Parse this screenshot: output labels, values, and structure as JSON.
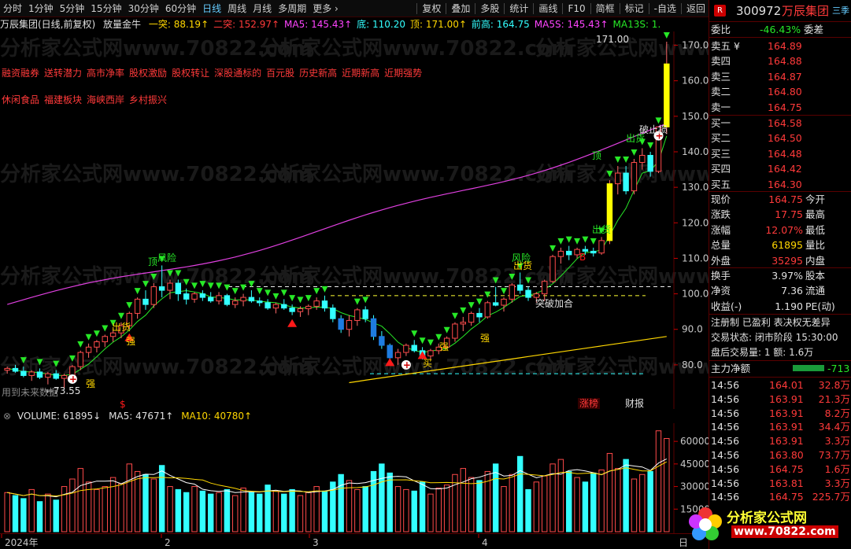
{
  "toolbar": {
    "left": [
      "分时",
      "1分钟",
      "5分钟",
      "15分钟",
      "30分钟",
      "60分钟",
      "日线",
      "周线",
      "月线",
      "多周期",
      "更多 ›"
    ],
    "active": "日线",
    "right": [
      "复权",
      "叠加",
      "多股",
      "统计",
      "画线",
      "F10",
      "简框",
      "标记",
      "-自选",
      "返回"
    ]
  },
  "title_row": {
    "name": "万辰集团(日线,前复权)",
    "indicator": "放量金牛",
    "items": [
      {
        "label": "一突: 88.19↑",
        "color": "#ffd700"
      },
      {
        "label": "二突: 152.97↑",
        "color": "#ff3a3a"
      },
      {
        "label": "MA5: 145.43↑",
        "color": "#ff44ff"
      },
      {
        "label": "底: 110.20",
        "color": "#33ffff"
      },
      {
        "label": "顶: 171.00↑",
        "color": "#ffd700"
      },
      {
        "label": "前高: 164.75",
        "color": "#33ffff"
      },
      {
        "label": "MA5S: 145.43↑",
        "color": "#ff44ff"
      },
      {
        "label": "MA13S: 1.",
        "color": "#27e827"
      }
    ]
  },
  "tags1": [
    "融资融券",
    "送转潜力",
    "高市净率",
    "股权激励",
    "股权转让",
    "深股通标的",
    "百元股",
    "历史新高",
    "近期新高",
    "近期强势"
  ],
  "tags2": [
    "休闲食品",
    "福建板块",
    "海峡西岸",
    "乡村振兴"
  ],
  "price_axis": [
    "170.0",
    "160.0",
    "150.0",
    "140.0",
    "130.0",
    "120.0",
    "110.0",
    "100.0",
    "90.0",
    "80.0"
  ],
  "chart_labels": {
    "high_mark": "171.00",
    "low_mark": "73.55",
    "future_text": "用到未来数据",
    "breakout": "突破加合",
    "stoploss": "破止损",
    "signal_top": "顶",
    "signal_risk": "风险",
    "signal_ship": "出货",
    "signal_strong": "强",
    "signal_buy": "买",
    "signal_b": "B",
    "signal_s": "$",
    "zt_tag": "涨榜",
    "cb_tag": "财报"
  },
  "volume_header": {
    "name": "VOLUME: 61895↓",
    "ma5": "MA5: 47671↑",
    "ma10": "MA10: 40780↑"
  },
  "volume_axis": [
    "60000",
    "45000",
    "30000",
    "15000"
  ],
  "date_axis": [
    "2024年",
    "2",
    "3",
    "4"
  ],
  "date_end": "日",
  "right_panel": {
    "code": "300972",
    "name": "万辰集团",
    "badge": "R",
    "wb_label": "委比",
    "wb_value": "-46.43%",
    "wc_label": "委差",
    "sells": [
      {
        "label": "卖五",
        "price": "164.89",
        "flag": "¥"
      },
      {
        "label": "卖四",
        "price": "164.88",
        "flag": ""
      },
      {
        "label": "卖三",
        "price": "164.87",
        "flag": ""
      },
      {
        "label": "卖二",
        "price": "164.80",
        "flag": ""
      },
      {
        "label": "卖一",
        "price": "164.75",
        "flag": ""
      }
    ],
    "buys": [
      {
        "label": "买一",
        "price": "164.58"
      },
      {
        "label": "买二",
        "price": "164.50"
      },
      {
        "label": "买三",
        "price": "164.48"
      },
      {
        "label": "买四",
        "price": "164.42"
      },
      {
        "label": "买五",
        "price": "164.30"
      }
    ],
    "quote": [
      {
        "l1": "现价",
        "v1": "164.75",
        "c1": "red",
        "l2": "今开"
      },
      {
        "l1": "涨跌",
        "v1": "17.75",
        "c1": "red",
        "l2": "最高"
      },
      {
        "l1": "涨幅",
        "v1": "12.07%",
        "c1": "red",
        "l2": "最低"
      },
      {
        "l1": "总量",
        "v1": "61895",
        "c1": "yel",
        "l2": "量比"
      },
      {
        "l1": "外盘",
        "v1": "35295",
        "c1": "red",
        "l2": "内盘"
      }
    ],
    "info": [
      {
        "l1": "换手",
        "v1": "3.97%",
        "l2": "股本"
      },
      {
        "l1": "净资",
        "v1": "7.36",
        "l2": "流通"
      },
      {
        "l1": "收益(-)",
        "v1": "1.190",
        "l2": "PE(动)"
      }
    ],
    "status1": "注册制  已盈利  表决权无差异",
    "status2": "交易状态: 闭市阶段 15:30:00",
    "status3": "盘后交易量: 1  额: 1.6万",
    "main_force_label": "主力净额",
    "main_force_value": "-713",
    "ticks": [
      {
        "t": "14:56",
        "p": "164.01",
        "v": "32.8万"
      },
      {
        "t": "14:56",
        "p": "163.91",
        "v": "21.3万"
      },
      {
        "t": "14:56",
        "p": "163.91",
        "v": "8.2万"
      },
      {
        "t": "14:56",
        "p": "163.91",
        "v": "34.4万"
      },
      {
        "t": "14:56",
        "p": "163.91",
        "v": "3.3万"
      },
      {
        "t": "14:56",
        "p": "163.80",
        "v": "73.7万"
      },
      {
        "t": "14:56",
        "p": "164.75",
        "v": "1.6万"
      },
      {
        "t": "14:56",
        "p": "163.81",
        "v": "3.3万"
      },
      {
        "t": "14:56",
        "p": "164.75",
        "v": "225.7万"
      }
    ],
    "side_tab": "三季",
    "logo_text": "分析家公式网",
    "logo_url": "www.70822.com"
  },
  "watermark": "分析家公式网www.70822.com",
  "chart_data": {
    "type": "candlestick",
    "ylim": [
      72,
      173
    ],
    "candles": [
      [
        78.5,
        79.5,
        77.5,
        79
      ],
      [
        79,
        80,
        77.8,
        78.2
      ],
      [
        78.2,
        79.5,
        76.5,
        77
      ],
      [
        77,
        78.5,
        75.5,
        78
      ],
      [
        78,
        79,
        76,
        76.5
      ],
      [
        76.5,
        78,
        74.5,
        77.5
      ],
      [
        77.5,
        78.5,
        75.8,
        76.2
      ],
      [
        76.2,
        77.5,
        73.55,
        77
      ],
      [
        77,
        80,
        76,
        79.5
      ],
      [
        79.5,
        84,
        78.5,
        83.5
      ],
      [
        83.5,
        86,
        82,
        85
      ],
      [
        85,
        87,
        83.5,
        86.5
      ],
      [
        86.5,
        88.5,
        85,
        88
      ],
      [
        88,
        90,
        86.5,
        89
      ],
      [
        89,
        92,
        87.5,
        91
      ],
      [
        91,
        95,
        90,
        94.5
      ],
      [
        94.5,
        99,
        93,
        98.5
      ],
      [
        98.5,
        101,
        95.5,
        97
      ],
      [
        97,
        103,
        96,
        102
      ],
      [
        102,
        108,
        99,
        101
      ],
      [
        101,
        104,
        98.5,
        103
      ],
      [
        103,
        104,
        98,
        100
      ],
      [
        100,
        101.5,
        97,
        98.5
      ],
      [
        98.5,
        100.5,
        97.5,
        100
      ],
      [
        100,
        101,
        98,
        99
      ],
      [
        99,
        100.5,
        97.5,
        98
      ],
      [
        98,
        100.5,
        97,
        99.5
      ],
      [
        99.5,
        100,
        96.5,
        97
      ],
      [
        97,
        99,
        96,
        98
      ],
      [
        98,
        100,
        96.5,
        99
      ],
      [
        99,
        101,
        97.5,
        98
      ],
      [
        98,
        99,
        96.5,
        97.5
      ],
      [
        97.5,
        98.5,
        95.5,
        96
      ],
      [
        96,
        97.5,
        94.5,
        97
      ],
      [
        97,
        98.5,
        95.5,
        96
      ],
      [
        96,
        97,
        94,
        95
      ],
      [
        95,
        96.5,
        93.5,
        95.8
      ],
      [
        95.8,
        97,
        94,
        96.5
      ],
      [
        96.5,
        99,
        95.5,
        98
      ],
      [
        98,
        99.5,
        95,
        96
      ],
      [
        96,
        97,
        92,
        93
      ],
      [
        93,
        94,
        89,
        90
      ],
      [
        90,
        94,
        88,
        92.5
      ],
      [
        92.5,
        96,
        91,
        95.5
      ],
      [
        95.5,
        96.5,
        92,
        93
      ],
      [
        93,
        94,
        87,
        88
      ],
      [
        88,
        89.5,
        84.5,
        85.5
      ],
      [
        85.5,
        86,
        80.5,
        82
      ],
      [
        82,
        84.5,
        80,
        83.5
      ],
      [
        83.5,
        86,
        82.5,
        85.5
      ],
      [
        85.5,
        87,
        83.5,
        84
      ],
      [
        84,
        85,
        81.5,
        82.5
      ],
      [
        82.5,
        84.5,
        81.5,
        84
      ],
      [
        84,
        86,
        83,
        85
      ],
      [
        85,
        88,
        84.5,
        87.5
      ],
      [
        87.5,
        92,
        86.5,
        91.5
      ],
      [
        91.5,
        93.5,
        89.5,
        92
      ],
      [
        92,
        95,
        91,
        94.5
      ],
      [
        94.5,
        96,
        92,
        93.5
      ],
      [
        93.5,
        98,
        93,
        97.5
      ],
      [
        97.5,
        102,
        96.5,
        96.8
      ],
      [
        96.8,
        99,
        95,
        98.5
      ],
      [
        98.5,
        103,
        97.5,
        102.5
      ],
      [
        102.5,
        106,
        100,
        101
      ],
      [
        101,
        102,
        98,
        99
      ],
      [
        99,
        100.5,
        97.5,
        100
      ],
      [
        100,
        104,
        98,
        103.5
      ],
      [
        103.5,
        111,
        103,
        110.5
      ],
      [
        110.5,
        113,
        108.5,
        112
      ],
      [
        112,
        113.5,
        109.5,
        111
      ],
      [
        111,
        113,
        110,
        112.5
      ],
      [
        112.5,
        113.5,
        111,
        112
      ],
      [
        112,
        113,
        110.5,
        111.5
      ],
      [
        111.5,
        116,
        111,
        115
      ],
      [
        115,
        132,
        114,
        131
      ],
      [
        131,
        136,
        128,
        134
      ],
      [
        134,
        136,
        128,
        129
      ],
      [
        129,
        138,
        128,
        137
      ],
      [
        137,
        141,
        135,
        139
      ],
      [
        139,
        140,
        133,
        134.5
      ],
      [
        134.5,
        147,
        134,
        147
      ],
      [
        147,
        171,
        145,
        164.75
      ]
    ],
    "volume": [
      26000,
      24000,
      22000,
      28000,
      20000,
      25000,
      21000,
      30000,
      35000,
      42000,
      33000,
      28000,
      30000,
      36000,
      32000,
      45000,
      40000,
      38000,
      35000,
      44000,
      30000,
      28000,
      26000,
      30000,
      27000,
      25000,
      26000,
      28000,
      24000,
      29000,
      26000,
      25000,
      31000,
      27000,
      25000,
      28000,
      24000,
      26000,
      30000,
      27000,
      33000,
      38000,
      34000,
      28000,
      30000,
      40000,
      45000,
      39000,
      30000,
      28000,
      27000,
      33000,
      25000,
      29000,
      31000,
      38000,
      42000,
      36000,
      34000,
      40000,
      45000,
      30000,
      38000,
      50000,
      28000,
      33000,
      37000,
      45000,
      48000,
      40000,
      36000,
      33000,
      39000,
      41000,
      52000,
      42000,
      48000,
      35000,
      38000,
      40000,
      67000,
      61895
    ],
    "ma_lines": [
      "MA5",
      "二突 (magenta)",
      "一突 (yellow)"
    ]
  }
}
